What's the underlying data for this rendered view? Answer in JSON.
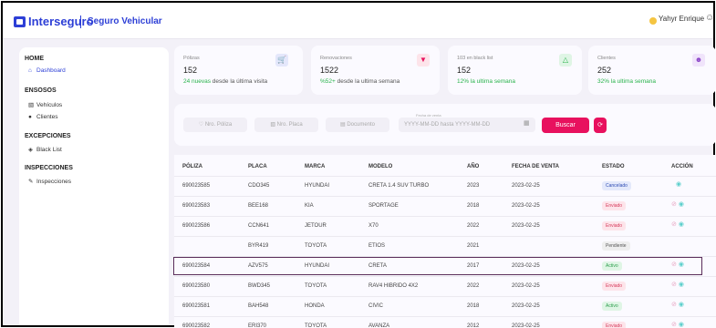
{
  "brand": {
    "logo": "Interseguro",
    "product": "Seguro Vehicular"
  },
  "user": {
    "name": "Yahyr Enrique"
  },
  "sidebar": {
    "sections": [
      {
        "title": "HOME",
        "items": [
          "Dashboard"
        ]
      },
      {
        "title": "ENSOSOS",
        "items": [
          "Vehículos",
          "Clientes"
        ]
      },
      {
        "title": "EXCEPCIONES",
        "items": [
          "Black List"
        ]
      },
      {
        "title": "INSPECCIONES",
        "items": [
          "Inspecciones"
        ]
      }
    ],
    "active_item": "Dashboard"
  },
  "cards": [
    {
      "label": "Pólizas",
      "value": "152",
      "delta": "24 nuevas",
      "delta_text": " desde la última visita",
      "icon": "cart-icon"
    },
    {
      "label": "Renovaciones",
      "value": "1522",
      "delta": "%52+",
      "delta_text": " desde la ultima semana",
      "icon": "tag-icon"
    },
    {
      "label": "103 en black list",
      "value": "152",
      "delta": "12% la ultima semana",
      "delta_text": "",
      "icon": "warning-icon"
    },
    {
      "label": "Clientes",
      "value": "252",
      "delta": "32% la ultima semana",
      "delta_text": "",
      "icon": "users-icon"
    }
  ],
  "filters": {
    "poliza_placeholder": "Nro. Póliza",
    "placa_placeholder": "Nro. Placa",
    "documento_placeholder": "Documento",
    "fecha_label": "Fecha de venta",
    "fecha_placeholder": "YYYY-MM-DD hasta YYYY-MM-DD",
    "buscar_label": "Buscar"
  },
  "table": {
    "headers": [
      "PÓLIZA",
      "PLACA",
      "MARCA",
      "MODELO",
      "AÑO",
      "FECHA DE VENTA",
      "ESTADO",
      "ACCIÓN"
    ],
    "rows": [
      [
        "690023585",
        "CDO345",
        "HYUNDAI",
        "CRETA 1.4 SUV TURBO",
        "2023",
        "2023-02-25",
        "Cancelado"
      ],
      [
        "690023583",
        "BEE168",
        "KIA",
        "SPORTAGE",
        "2018",
        "2023-02-25",
        "Enviado"
      ],
      [
        "690023586",
        "CCN641",
        "JETOUR",
        "X70",
        "2022",
        "2023-02-25",
        "Enviado"
      ],
      [
        "",
        "BYR419",
        "TOYOTA",
        "ETIOS",
        "2021",
        "",
        "Pendiente"
      ],
      [
        "690023584",
        "AZV575",
        "HYUNDAI",
        "CRETA",
        "2017",
        "2023-02-25",
        "Activo"
      ],
      [
        "690023580",
        "BWD345",
        "TOYOTA",
        "RAV4 HIBRIDO 4X2",
        "2022",
        "2023-02-25",
        "Enviado"
      ],
      [
        "690023581",
        "BAH548",
        "HONDA",
        "CIVIC",
        "2018",
        "2023-02-25",
        "Activo"
      ],
      [
        "690023582",
        "ERI370",
        "TOYOTA",
        "AVANZA",
        "2012",
        "2023-02-25",
        "Enviado"
      ]
    ],
    "highlighted_row": 4
  },
  "colors": {
    "brand": "#2d3fd6",
    "accent": "#e8115e",
    "background": "#f3f1f8"
  }
}
